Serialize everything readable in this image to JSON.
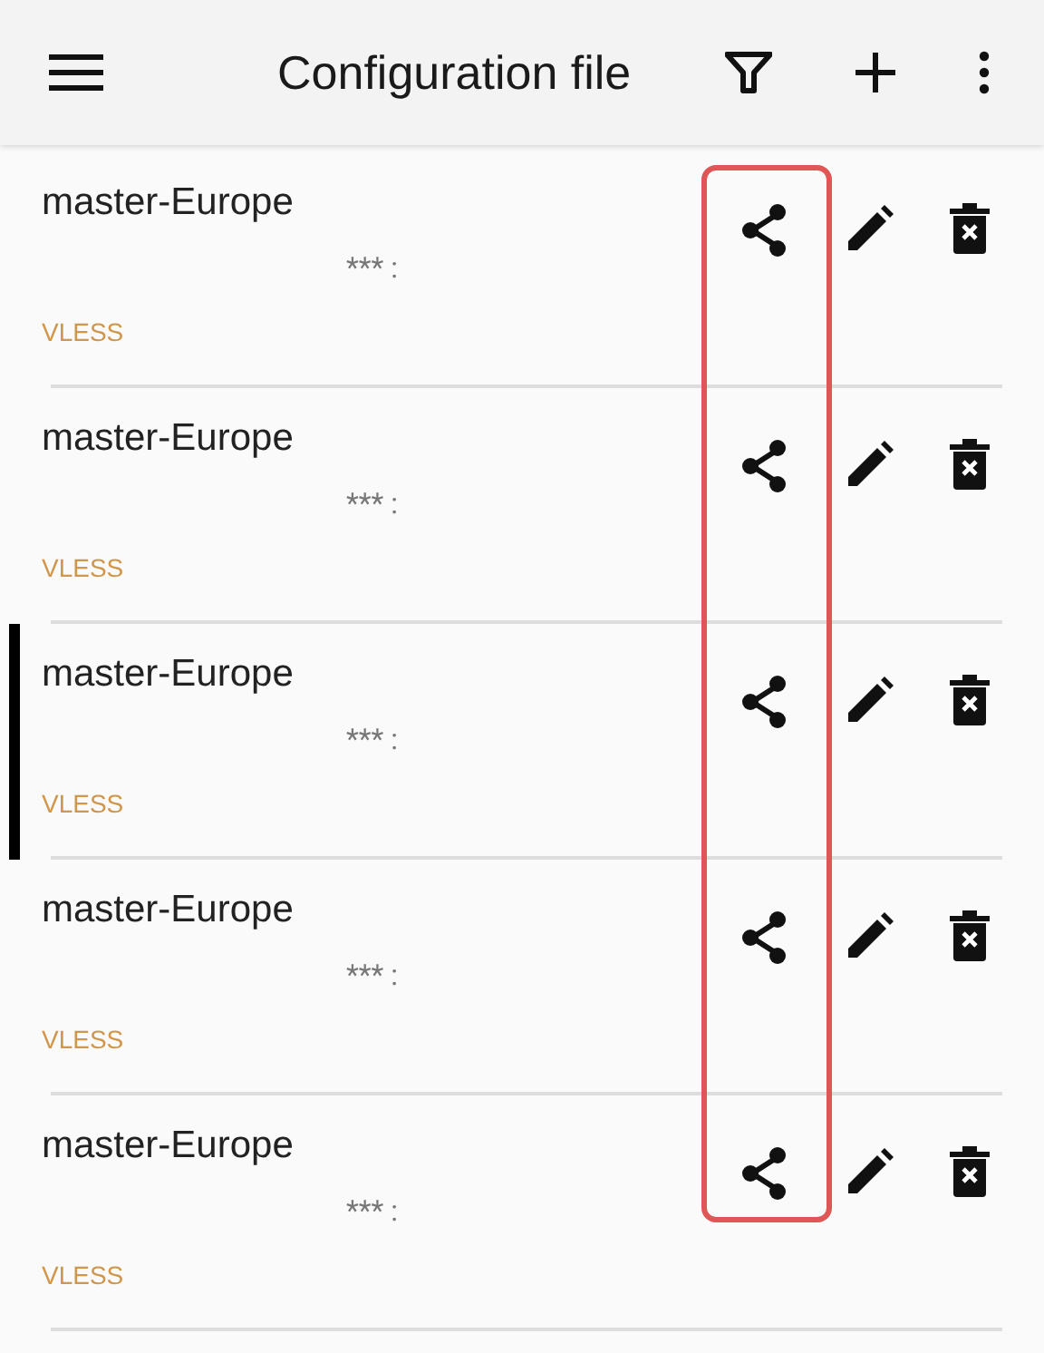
{
  "app_bar": {
    "title": "Configuration file"
  },
  "share_highlighted": true,
  "servers": [
    {
      "name": "master-Europe",
      "address": "*** :",
      "type": "VLESS",
      "selected": false
    },
    {
      "name": "master-Europe",
      "address": "*** :",
      "type": "VLESS",
      "selected": false
    },
    {
      "name": "master-Europe",
      "address": "*** :",
      "type": "VLESS",
      "selected": true
    },
    {
      "name": "master-Europe",
      "address": "*** :",
      "type": "VLESS",
      "selected": false
    },
    {
      "name": "master-Europe",
      "address": "*** :",
      "type": "VLESS",
      "selected": false
    }
  ]
}
